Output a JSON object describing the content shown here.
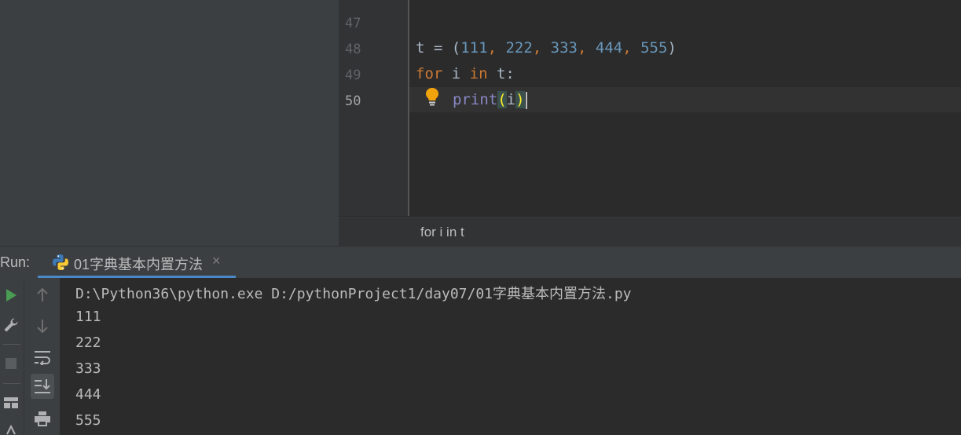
{
  "editor": {
    "lines": [
      {
        "number": "47",
        "text": ""
      },
      {
        "number": "48",
        "text": "t = (111, 222, 333, 444, 555)"
      },
      {
        "number": "49",
        "text": "for i in t:"
      },
      {
        "number": "50",
        "text": "print(i)"
      }
    ],
    "tokens": {
      "t": "t",
      "eq": " = ",
      "lparen": "(",
      "n1": "111",
      "n2": "222",
      "n3": "333",
      "n4": "444",
      "n5": "555",
      "comma": ", ",
      "rparen": ")",
      "kw_for": "for",
      "i_var": " i ",
      "kw_in": "in",
      "iter": " t:",
      "print": "print",
      "p_open": "(",
      "p_arg": "i",
      "p_close": ")"
    },
    "breadcrumb": "for i in t"
  },
  "run": {
    "label": "Run:",
    "tab_label": "01字典基本内置方法",
    "close": "×",
    "output": [
      "D:\\Python36\\python.exe D:/pythonProject1/day07/01字典基本内置方法.py",
      "111",
      "222",
      "333",
      "444",
      "555"
    ]
  },
  "icons": {
    "rerun": "play-icon",
    "settings": "wrench-icon",
    "stop": "stop-icon",
    "layout": "layout-icon",
    "up": "arrow-up-icon",
    "down": "arrow-down-icon",
    "wrap": "soft-wrap-icon",
    "scroll": "scroll-to-end-icon",
    "print": "printer-icon"
  },
  "colors": {
    "keyword": "#cc7832",
    "number": "#6897bb",
    "builtin": "#8888c6",
    "accent": "#4a88c7",
    "run_green": "#499c54"
  }
}
